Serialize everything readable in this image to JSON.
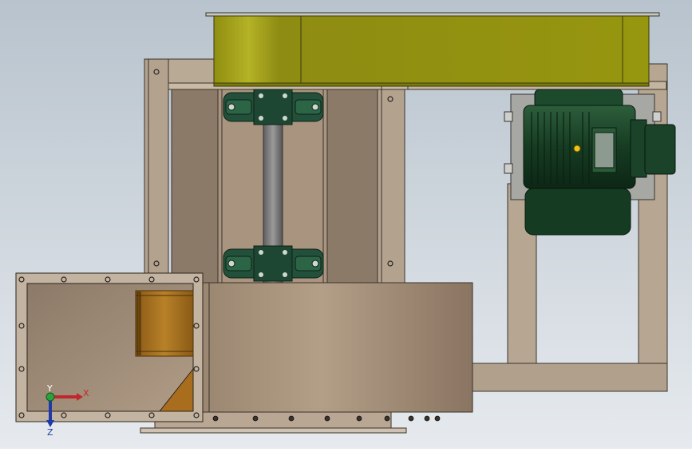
{
  "viewport": {
    "background_top": "#b8c3cd",
    "background_bottom": "#e6eaee"
  },
  "colors": {
    "frame": "#b4a48f",
    "frame_dark": "#6f6456",
    "frame_light": "#d6c8b4",
    "belt_guard": "#9b9a12",
    "belt_guard_light": "#b7b427",
    "motor": "#1b4a2a",
    "motor_dark": "#0f2e1a",
    "bearing": "#22503a",
    "shaft": "#7c7c7c",
    "housing": "#a8937b",
    "damper": "#b07a22",
    "duct_interior": "#9c8a78",
    "axis_x": "#c0282d",
    "axis_y": "#2aa33a",
    "axis_z": "#1f3aa8",
    "grease_nipple": "#f2c21b"
  },
  "triad": {
    "x_label": "X",
    "y_label": "Y",
    "z_label": "Z"
  }
}
